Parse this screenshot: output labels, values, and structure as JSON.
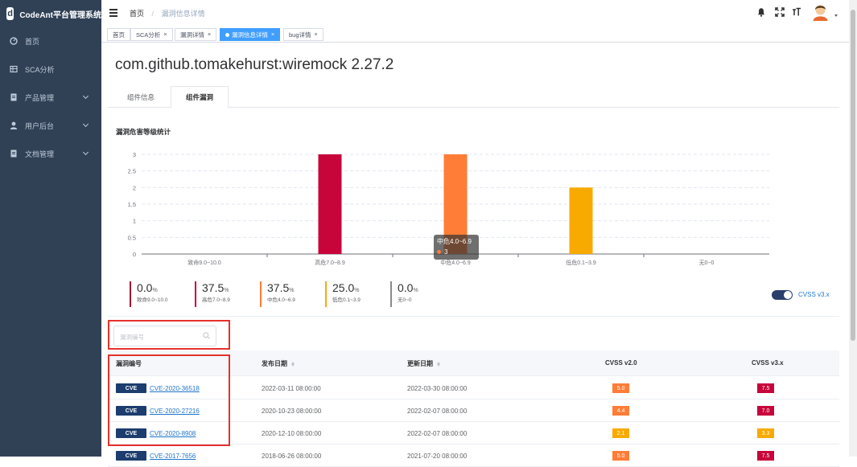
{
  "app": {
    "name": "CodeAnt平台管理系统",
    "logo_glyph": "d"
  },
  "sidebar": {
    "items": [
      {
        "label": "首页",
        "icon": "dashboard-icon",
        "has_children": false
      },
      {
        "label": "SCA分析",
        "icon": "list-icon",
        "has_children": false
      },
      {
        "label": "产品管理",
        "icon": "document-icon",
        "has_children": true
      },
      {
        "label": "用户后台",
        "icon": "user-icon",
        "has_children": true
      },
      {
        "label": "文档管理",
        "icon": "document-icon",
        "has_children": true
      }
    ]
  },
  "navbar": {
    "breadcrumb": {
      "home": "首页",
      "separator": "/",
      "current": "漏洞信息详情"
    },
    "icons": [
      "bell-icon",
      "fullscreen-icon",
      "font-size-icon"
    ]
  },
  "tags": [
    {
      "label": "首页",
      "active": false,
      "closable": false
    },
    {
      "label": "SCA分析",
      "active": false,
      "closable": true
    },
    {
      "label": "漏洞详情",
      "active": false,
      "closable": true
    },
    {
      "label": "漏洞信息详情",
      "active": true,
      "closable": true
    },
    {
      "label": "bug详情",
      "active": false,
      "closable": true
    }
  ],
  "page": {
    "title": "com.github.tomakehurst:wiremock 2.27.2"
  },
  "tabs": [
    {
      "label": "组件信息",
      "active": false
    },
    {
      "label": "组件漏洞",
      "active": true
    }
  ],
  "chart_section": {
    "title": "漏洞危害等级统计"
  },
  "chart_data": {
    "type": "bar",
    "categories": [
      "致命9.0~10.0",
      "高危7.0~8.9",
      "中危4.0~6.9",
      "低危0.1~3.9",
      "无0~0"
    ],
    "values": [
      0,
      3,
      3,
      2,
      0
    ],
    "colors": [
      "#c51a2c",
      "#c8053a",
      "#ff7d36",
      "#f9aa00",
      "#9e9e9e"
    ],
    "yticks": [
      "0",
      "0.5",
      "1",
      "1.5",
      "2",
      "2.5",
      "3"
    ],
    "ylim": [
      0,
      3
    ],
    "grid": true,
    "tooltip": {
      "title": "中危4.0~6.9",
      "value": "3"
    }
  },
  "stats": [
    {
      "value": "0.0",
      "unit": "%",
      "label": "致命9.0~10.0",
      "color": "#a2142f"
    },
    {
      "value": "37.5",
      "unit": "%",
      "label": "高危7.0~8.9",
      "color": "#c8053a"
    },
    {
      "value": "37.5",
      "unit": "%",
      "label": "中危4.0~6.9",
      "color": "#ff7d36"
    },
    {
      "value": "25.0",
      "unit": "%",
      "label": "低危0.1~3.9",
      "color": "#f9aa00"
    },
    {
      "value": "0.0",
      "unit": "%",
      "label": "无0~0",
      "color": "#8a8a8a"
    }
  ],
  "cvss_toggle": {
    "label": "CVSS v3.x",
    "on": true
  },
  "search": {
    "placeholder": "漏洞编号"
  },
  "table": {
    "columns": [
      "漏洞编号",
      "发布日期",
      "更新日期",
      "CVSS v2.0",
      "CVSS v3.x"
    ],
    "rows": [
      {
        "badge": "CVE",
        "id": "CVE-2020-36518",
        "published": "2022-03-11 08:00:00",
        "updated": "2022-03-30 08:00:00",
        "v2": "5.0",
        "v2_color": "#ff7d36",
        "v3": "7.5",
        "v3_color": "#c8053a"
      },
      {
        "badge": "CVE",
        "id": "CVE-2020-27216",
        "published": "2020-10-23 08:00:00",
        "updated": "2022-02-07 08:00:00",
        "v2": "4.4",
        "v2_color": "#ff7d36",
        "v3": "7.0",
        "v3_color": "#c8053a"
      },
      {
        "badge": "CVE",
        "id": "CVE-2020-8908",
        "published": "2020-12-10 08:00:00",
        "updated": "2022-02-07 08:00:00",
        "v2": "2.1",
        "v2_color": "#f9aa00",
        "v3": "3.3",
        "v3_color": "#f9aa00"
      },
      {
        "badge": "CVE",
        "id": "CVE-2017-7656",
        "published": "2018-06-26 08:00:00",
        "updated": "2021-07-20 08:00:00",
        "v2": "5.0",
        "v2_color": "#ff7d36",
        "v3": "7.5",
        "v3_color": "#c8053a"
      }
    ]
  }
}
